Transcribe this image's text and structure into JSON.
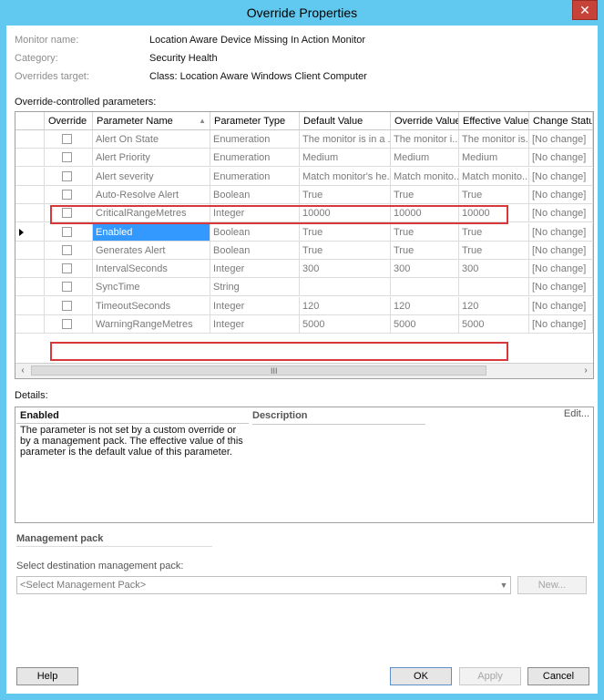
{
  "window": {
    "title": "Override Properties",
    "close_glyph": "✕"
  },
  "info": {
    "monitor_label": "Monitor name:",
    "monitor_value": "Location Aware Device Missing In Action Monitor",
    "category_label": "Category:",
    "category_value": "Security Health",
    "target_label": "Overrides target:",
    "target_value": "Class: Location Aware Windows Client Computer"
  },
  "grid": {
    "section_label": "Override-controlled parameters:",
    "columns": [
      "Override",
      "Parameter Name",
      "Parameter Type",
      "Default Value",
      "Override Value",
      "Effective Value",
      "Change Status"
    ],
    "rows": [
      [
        "Alert On State",
        "Enumeration",
        "The monitor is in a ...",
        "The monitor i...",
        "The monitor is...",
        "[No change]"
      ],
      [
        "Alert Priority",
        "Enumeration",
        "Medium",
        "Medium",
        "Medium",
        "[No change]"
      ],
      [
        "Alert severity",
        "Enumeration",
        "Match monitor's he...",
        "Match monito...",
        "Match monito...",
        "[No change]"
      ],
      [
        "Auto-Resolve Alert",
        "Boolean",
        "True",
        "True",
        "True",
        "[No change]"
      ],
      [
        "CriticalRangeMetres",
        "Integer",
        "10000",
        "10000",
        "10000",
        "[No change]"
      ],
      [
        "Enabled",
        "Boolean",
        "True",
        "True",
        "True",
        "[No change]"
      ],
      [
        "Generates Alert",
        "Boolean",
        "True",
        "True",
        "True",
        "[No change]"
      ],
      [
        "IntervalSeconds",
        "Integer",
        "300",
        "300",
        "300",
        "[No change]"
      ],
      [
        "SyncTime",
        "String",
        "",
        "",
        "",
        "[No change]"
      ],
      [
        "TimeoutSeconds",
        "Integer",
        "120",
        "120",
        "120",
        "[No change]"
      ],
      [
        "WarningRangeMetres",
        "Integer",
        "5000",
        "5000",
        "5000",
        "[No change]"
      ]
    ],
    "sort_glyph": "▲",
    "scroll_grip": "III"
  },
  "details": {
    "section_label": "Details:",
    "param_name": "Enabled",
    "description_header": "Description",
    "edit_link": "Edit...",
    "body": "The parameter is not set by a custom override or by a management pack. The effective value of this parameter is the default value of this parameter."
  },
  "management_pack": {
    "title": "Management pack",
    "select_label": "Select destination management pack:",
    "select_value": "<Select Management Pack>",
    "new_button": "New..."
  },
  "footer": {
    "help": "Help",
    "ok": "OK",
    "apply": "Apply",
    "cancel": "Cancel"
  },
  "colors": {
    "accent": "#61c9ef",
    "selection": "#3399ff",
    "highlight_box": "#d9383a"
  }
}
